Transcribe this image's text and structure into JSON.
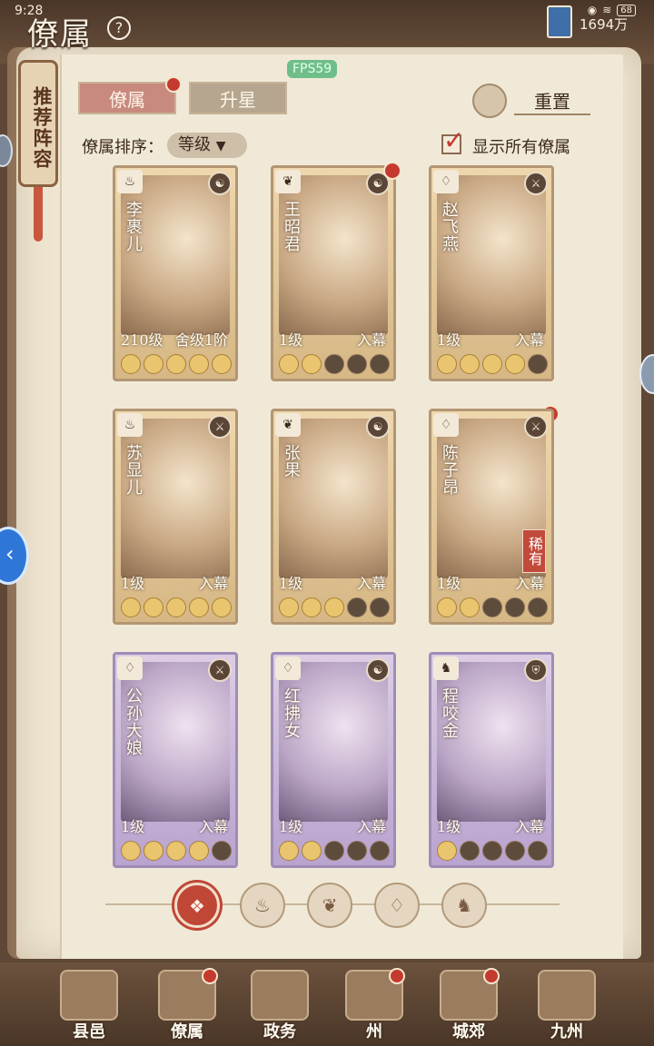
{
  "status": {
    "time": "9:28",
    "battery": "68"
  },
  "header": {
    "title": "僚属",
    "help_icon": "question-icon",
    "currency": "1694万"
  },
  "side_banner": "推荐阵容",
  "fps": "FPS59",
  "tabs": [
    {
      "label": "僚属",
      "active": true
    },
    {
      "label": "升星",
      "active": false
    }
  ],
  "reset_label": "重置",
  "sort": {
    "label": "僚属排序：",
    "value": "等级"
  },
  "show_all": {
    "label": "显示所有僚属",
    "checked": true
  },
  "cards": [
    {
      "name": "李裹儿",
      "level": "210级",
      "status": "舍级1阶",
      "stars": 5,
      "tier": "gold",
      "red_dot": false
    },
    {
      "name": "王昭君",
      "level": "1级",
      "status": "入幕",
      "stars": 2,
      "tier": "gold",
      "red_dot": true
    },
    {
      "name": "赵飞燕",
      "level": "1级",
      "status": "入幕",
      "stars": 4,
      "tier": "gold",
      "red_dot": false
    },
    {
      "name": "苏显儿",
      "level": "1级",
      "status": "入幕",
      "stars": 5,
      "tier": "gold",
      "red_dot": false
    },
    {
      "name": "张果",
      "level": "1级",
      "status": "入幕",
      "stars": 3,
      "tier": "gold",
      "red_dot": false
    },
    {
      "name": "陈子昂",
      "level": "1级",
      "status": "入幕",
      "stars": 2,
      "tier": "gold",
      "red_dot": true,
      "badge": "稀有"
    },
    {
      "name": "公孙大娘",
      "level": "1级",
      "status": "入幕",
      "stars": 4,
      "tier": "purple",
      "red_dot": false
    },
    {
      "name": "红拂女",
      "level": "1级",
      "status": "入幕",
      "stars": 2,
      "tier": "purple",
      "red_dot": false
    },
    {
      "name": "程咬金",
      "level": "1级",
      "status": "入幕",
      "stars": 1,
      "tier": "purple",
      "red_dot": false
    }
  ],
  "filters": [
    "all-filter-icon",
    "calabash-icon",
    "gourd-icon",
    "fan-icon",
    "mount-icon"
  ],
  "bottom_nav": [
    {
      "label": "县邑",
      "red_dot": false
    },
    {
      "label": "僚属",
      "red_dot": true
    },
    {
      "label": "政务",
      "red_dot": false
    },
    {
      "label": "州",
      "red_dot": true
    },
    {
      "label": "城郊",
      "red_dot": true
    },
    {
      "label": "九州",
      "red_dot": false
    }
  ]
}
